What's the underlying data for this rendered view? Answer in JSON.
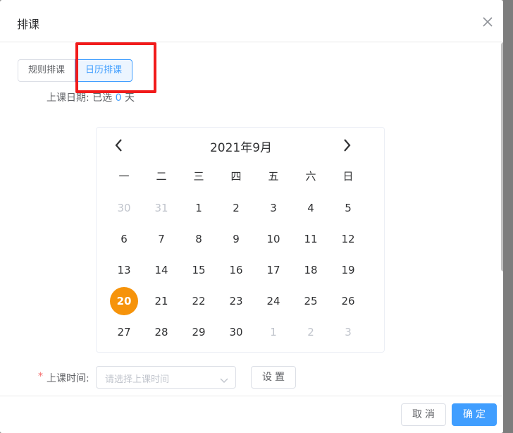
{
  "dialog": {
    "title": "排课"
  },
  "tabs": [
    {
      "label": "规则排课",
      "active": false
    },
    {
      "label": "日历排课",
      "active": true
    }
  ],
  "date_summary": {
    "label": "上课日期:",
    "prefix": "已选",
    "count": "0",
    "suffix": "天"
  },
  "calendar": {
    "title": "2021年9月",
    "weekdays": [
      "一",
      "二",
      "三",
      "四",
      "五",
      "六",
      "日"
    ],
    "weeks": [
      [
        {
          "d": "30",
          "muted": true
        },
        {
          "d": "31",
          "muted": true
        },
        {
          "d": "1"
        },
        {
          "d": "2"
        },
        {
          "d": "3"
        },
        {
          "d": "4"
        },
        {
          "d": "5"
        }
      ],
      [
        {
          "d": "6"
        },
        {
          "d": "7"
        },
        {
          "d": "8"
        },
        {
          "d": "9"
        },
        {
          "d": "10"
        },
        {
          "d": "11"
        },
        {
          "d": "12"
        }
      ],
      [
        {
          "d": "13"
        },
        {
          "d": "14"
        },
        {
          "d": "15"
        },
        {
          "d": "16"
        },
        {
          "d": "17"
        },
        {
          "d": "18"
        },
        {
          "d": "19"
        }
      ],
      [
        {
          "d": "20",
          "selected": true
        },
        {
          "d": "21"
        },
        {
          "d": "22"
        },
        {
          "d": "23"
        },
        {
          "d": "24"
        },
        {
          "d": "25"
        },
        {
          "d": "26"
        }
      ],
      [
        {
          "d": "27"
        },
        {
          "d": "28"
        },
        {
          "d": "29"
        },
        {
          "d": "30"
        },
        {
          "d": "1",
          "muted": true
        },
        {
          "d": "2",
          "muted": true
        },
        {
          "d": "3",
          "muted": true
        }
      ]
    ]
  },
  "time": {
    "required_mark": "*",
    "label": "上课时间:",
    "placeholder": "请选择上课时间",
    "set_button": "设置"
  },
  "footer": {
    "cancel_label": "取消",
    "confirm_label": "确定"
  },
  "colors": {
    "accent": "#409eff",
    "selected_day": "#f6930a",
    "highlight": "#f11b1b"
  }
}
